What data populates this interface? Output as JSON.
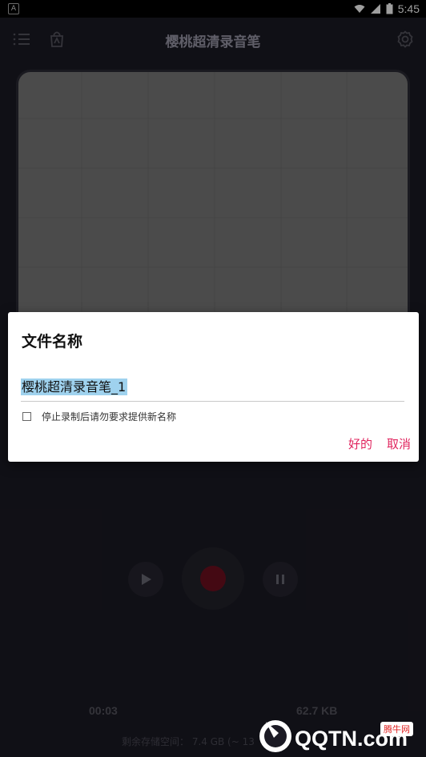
{
  "status_bar": {
    "time": "5:45",
    "left_icon": "A"
  },
  "app_bar": {
    "title": "樱桃超清录音笔"
  },
  "dialog": {
    "title": "文件名称",
    "filename_value": "樱桃超清录音笔_1",
    "checkbox_label": "停止录制后请勿要求提供新名称",
    "ok_label": "好的",
    "cancel_label": "取消"
  },
  "stats": {
    "duration": "00:03",
    "size": "62.7 KB"
  },
  "storage": {
    "text": "剩余存储空间： 7.4 GB (~ 13"
  },
  "watermark": {
    "text": "QQTN.com",
    "badge": "腾牛网"
  },
  "colors": {
    "accent": "#e0245e",
    "record": "#b3122b",
    "background": "#1b1a24"
  }
}
